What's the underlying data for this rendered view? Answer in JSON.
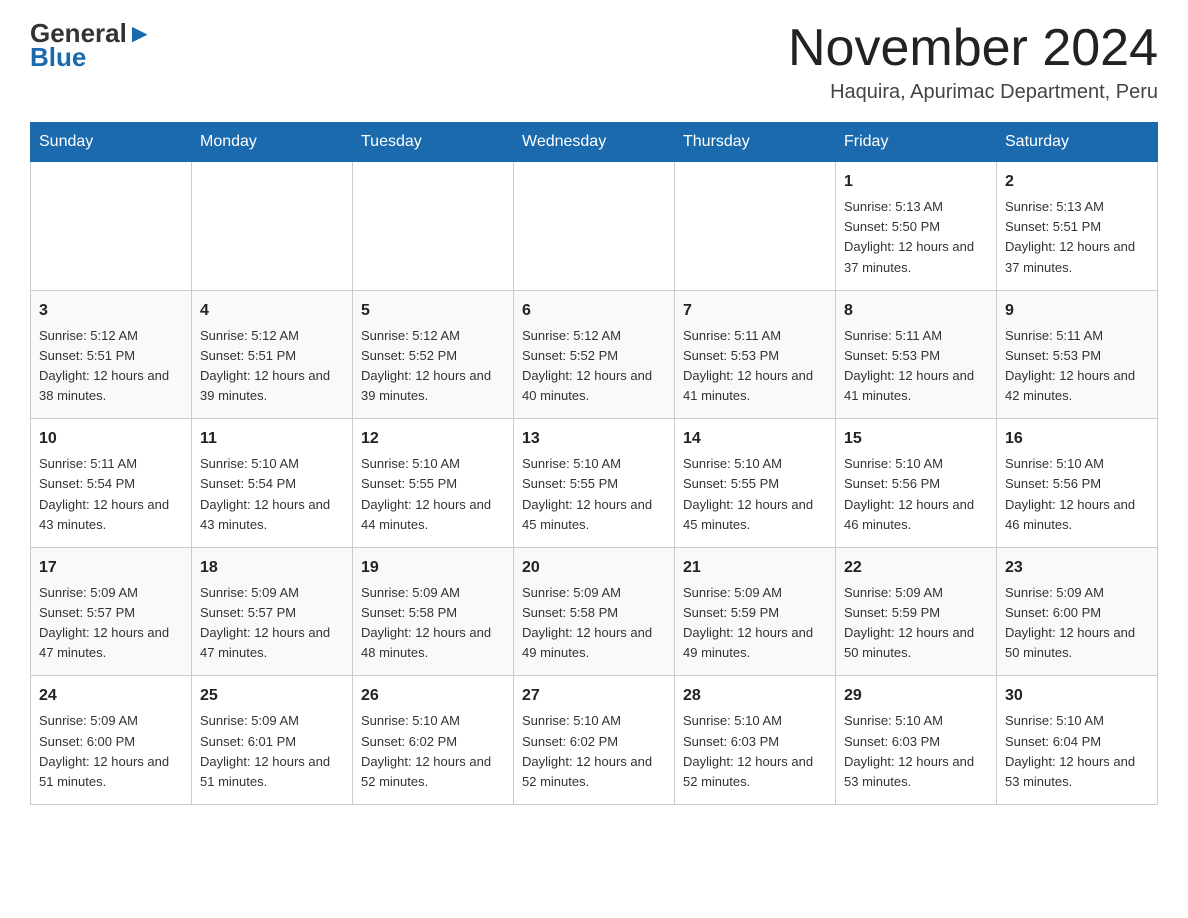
{
  "logo": {
    "general": "General",
    "blue": "Blue"
  },
  "title": {
    "month_year": "November 2024",
    "location": "Haquira, Apurimac Department, Peru"
  },
  "days_of_week": [
    "Sunday",
    "Monday",
    "Tuesday",
    "Wednesday",
    "Thursday",
    "Friday",
    "Saturday"
  ],
  "weeks": [
    [
      {
        "day": "",
        "sunrise": "",
        "sunset": "",
        "daylight": ""
      },
      {
        "day": "",
        "sunrise": "",
        "sunset": "",
        "daylight": ""
      },
      {
        "day": "",
        "sunrise": "",
        "sunset": "",
        "daylight": ""
      },
      {
        "day": "",
        "sunrise": "",
        "sunset": "",
        "daylight": ""
      },
      {
        "day": "",
        "sunrise": "",
        "sunset": "",
        "daylight": ""
      },
      {
        "day": "1",
        "sunrise": "Sunrise: 5:13 AM",
        "sunset": "Sunset: 5:50 PM",
        "daylight": "Daylight: 12 hours and 37 minutes."
      },
      {
        "day": "2",
        "sunrise": "Sunrise: 5:13 AM",
        "sunset": "Sunset: 5:51 PM",
        "daylight": "Daylight: 12 hours and 37 minutes."
      }
    ],
    [
      {
        "day": "3",
        "sunrise": "Sunrise: 5:12 AM",
        "sunset": "Sunset: 5:51 PM",
        "daylight": "Daylight: 12 hours and 38 minutes."
      },
      {
        "day": "4",
        "sunrise": "Sunrise: 5:12 AM",
        "sunset": "Sunset: 5:51 PM",
        "daylight": "Daylight: 12 hours and 39 minutes."
      },
      {
        "day": "5",
        "sunrise": "Sunrise: 5:12 AM",
        "sunset": "Sunset: 5:52 PM",
        "daylight": "Daylight: 12 hours and 39 minutes."
      },
      {
        "day": "6",
        "sunrise": "Sunrise: 5:12 AM",
        "sunset": "Sunset: 5:52 PM",
        "daylight": "Daylight: 12 hours and 40 minutes."
      },
      {
        "day": "7",
        "sunrise": "Sunrise: 5:11 AM",
        "sunset": "Sunset: 5:53 PM",
        "daylight": "Daylight: 12 hours and 41 minutes."
      },
      {
        "day": "8",
        "sunrise": "Sunrise: 5:11 AM",
        "sunset": "Sunset: 5:53 PM",
        "daylight": "Daylight: 12 hours and 41 minutes."
      },
      {
        "day": "9",
        "sunrise": "Sunrise: 5:11 AM",
        "sunset": "Sunset: 5:53 PM",
        "daylight": "Daylight: 12 hours and 42 minutes."
      }
    ],
    [
      {
        "day": "10",
        "sunrise": "Sunrise: 5:11 AM",
        "sunset": "Sunset: 5:54 PM",
        "daylight": "Daylight: 12 hours and 43 minutes."
      },
      {
        "day": "11",
        "sunrise": "Sunrise: 5:10 AM",
        "sunset": "Sunset: 5:54 PM",
        "daylight": "Daylight: 12 hours and 43 minutes."
      },
      {
        "day": "12",
        "sunrise": "Sunrise: 5:10 AM",
        "sunset": "Sunset: 5:55 PM",
        "daylight": "Daylight: 12 hours and 44 minutes."
      },
      {
        "day": "13",
        "sunrise": "Sunrise: 5:10 AM",
        "sunset": "Sunset: 5:55 PM",
        "daylight": "Daylight: 12 hours and 45 minutes."
      },
      {
        "day": "14",
        "sunrise": "Sunrise: 5:10 AM",
        "sunset": "Sunset: 5:55 PM",
        "daylight": "Daylight: 12 hours and 45 minutes."
      },
      {
        "day": "15",
        "sunrise": "Sunrise: 5:10 AM",
        "sunset": "Sunset: 5:56 PM",
        "daylight": "Daylight: 12 hours and 46 minutes."
      },
      {
        "day": "16",
        "sunrise": "Sunrise: 5:10 AM",
        "sunset": "Sunset: 5:56 PM",
        "daylight": "Daylight: 12 hours and 46 minutes."
      }
    ],
    [
      {
        "day": "17",
        "sunrise": "Sunrise: 5:09 AM",
        "sunset": "Sunset: 5:57 PM",
        "daylight": "Daylight: 12 hours and 47 minutes."
      },
      {
        "day": "18",
        "sunrise": "Sunrise: 5:09 AM",
        "sunset": "Sunset: 5:57 PM",
        "daylight": "Daylight: 12 hours and 47 minutes."
      },
      {
        "day": "19",
        "sunrise": "Sunrise: 5:09 AM",
        "sunset": "Sunset: 5:58 PM",
        "daylight": "Daylight: 12 hours and 48 minutes."
      },
      {
        "day": "20",
        "sunrise": "Sunrise: 5:09 AM",
        "sunset": "Sunset: 5:58 PM",
        "daylight": "Daylight: 12 hours and 49 minutes."
      },
      {
        "day": "21",
        "sunrise": "Sunrise: 5:09 AM",
        "sunset": "Sunset: 5:59 PM",
        "daylight": "Daylight: 12 hours and 49 minutes."
      },
      {
        "day": "22",
        "sunrise": "Sunrise: 5:09 AM",
        "sunset": "Sunset: 5:59 PM",
        "daylight": "Daylight: 12 hours and 50 minutes."
      },
      {
        "day": "23",
        "sunrise": "Sunrise: 5:09 AM",
        "sunset": "Sunset: 6:00 PM",
        "daylight": "Daylight: 12 hours and 50 minutes."
      }
    ],
    [
      {
        "day": "24",
        "sunrise": "Sunrise: 5:09 AM",
        "sunset": "Sunset: 6:00 PM",
        "daylight": "Daylight: 12 hours and 51 minutes."
      },
      {
        "day": "25",
        "sunrise": "Sunrise: 5:09 AM",
        "sunset": "Sunset: 6:01 PM",
        "daylight": "Daylight: 12 hours and 51 minutes."
      },
      {
        "day": "26",
        "sunrise": "Sunrise: 5:10 AM",
        "sunset": "Sunset: 6:02 PM",
        "daylight": "Daylight: 12 hours and 52 minutes."
      },
      {
        "day": "27",
        "sunrise": "Sunrise: 5:10 AM",
        "sunset": "Sunset: 6:02 PM",
        "daylight": "Daylight: 12 hours and 52 minutes."
      },
      {
        "day": "28",
        "sunrise": "Sunrise: 5:10 AM",
        "sunset": "Sunset: 6:03 PM",
        "daylight": "Daylight: 12 hours and 52 minutes."
      },
      {
        "day": "29",
        "sunrise": "Sunrise: 5:10 AM",
        "sunset": "Sunset: 6:03 PM",
        "daylight": "Daylight: 12 hours and 53 minutes."
      },
      {
        "day": "30",
        "sunrise": "Sunrise: 5:10 AM",
        "sunset": "Sunset: 6:04 PM",
        "daylight": "Daylight: 12 hours and 53 minutes."
      }
    ]
  ]
}
